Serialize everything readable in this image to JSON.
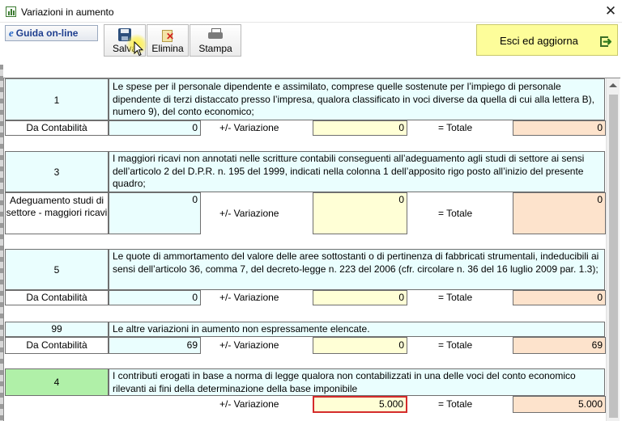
{
  "window": {
    "title": "Variazioni in aumento",
    "close_glyph": "✕"
  },
  "toolbar": {
    "guida_label": "Guida on-line",
    "guida_icon": "e",
    "save_label": "Salva",
    "delete_label": "Elimina",
    "print_label": "Stampa",
    "exit_label": "Esci ed aggiorna"
  },
  "rows": [
    {
      "number": "1",
      "description": "Le spese per il personale dipendente e assimilato, comprese quelle sostenute per l’impiego di personale dipendente di terzi distaccato presso l’impresa, qualora classificato in voci diverse da quella di cui alla lettera B), numero 9), del conto economico;",
      "label": "Da Contabilità",
      "contabilita": "0",
      "variazione_label": "+/-  Variazione",
      "variazione": "0",
      "totale_label": "= Totale",
      "totale": "0"
    },
    {
      "number": "3",
      "description": "I maggiori ricavi non annotati nelle scritture contabili conseguenti all’adeguamento agli studi di settore ai sensi dell’articolo 2 del D.P.R. n. 195 del 1999, indicati nella colonna 1 dell’apposito rigo posto all’inizio del presente quadro;",
      "label": "Adeguamento studi di settore - maggiori ricavi",
      "contabilita": "0",
      "variazione_label": "+/-  Variazione",
      "variazione": "0",
      "totale_label": "= Totale",
      "totale": "0"
    },
    {
      "number": "5",
      "description": "Le quote di ammortamento del valore delle aree sottostanti o di pertinenza di fabbricati strumentali, indeducibili ai sensi dell’articolo 36, comma 7, del decreto-legge n. 223 del 2006 (cfr. circolare n. 36 del 16 luglio 2009 par. 1.3);",
      "label": "Da Contabilità",
      "contabilita": "0",
      "variazione_label": "+/-  Variazione",
      "variazione": "0",
      "totale_label": "= Totale",
      "totale": "0"
    },
    {
      "number": "99",
      "description": "Le altre variazioni in aumento non espressamente elencate.",
      "label": "Da Contabilità",
      "contabilita": "69",
      "variazione_label": "+/-  Variazione",
      "variazione": "0",
      "totale_label": "= Totale",
      "totale": "69"
    },
    {
      "number": "4",
      "description": "I contributi erogati in base a norma di legge qualora non contabilizzati in una delle voci del conto economico rilevanti ai fini della determinazione della base imponibile",
      "variazione_label": "+/-  Variazione",
      "variazione": "5.000",
      "totale_label": "= Totale",
      "totale": "5.000"
    }
  ],
  "colors": {
    "cyan_field": "#eafefe",
    "yellow_field": "#ffffd6",
    "peach_field": "#fde3cc",
    "green_cell": "#b0f0a8",
    "exit_button": "#fdfd9a",
    "active_border": "#d42b2b"
  }
}
